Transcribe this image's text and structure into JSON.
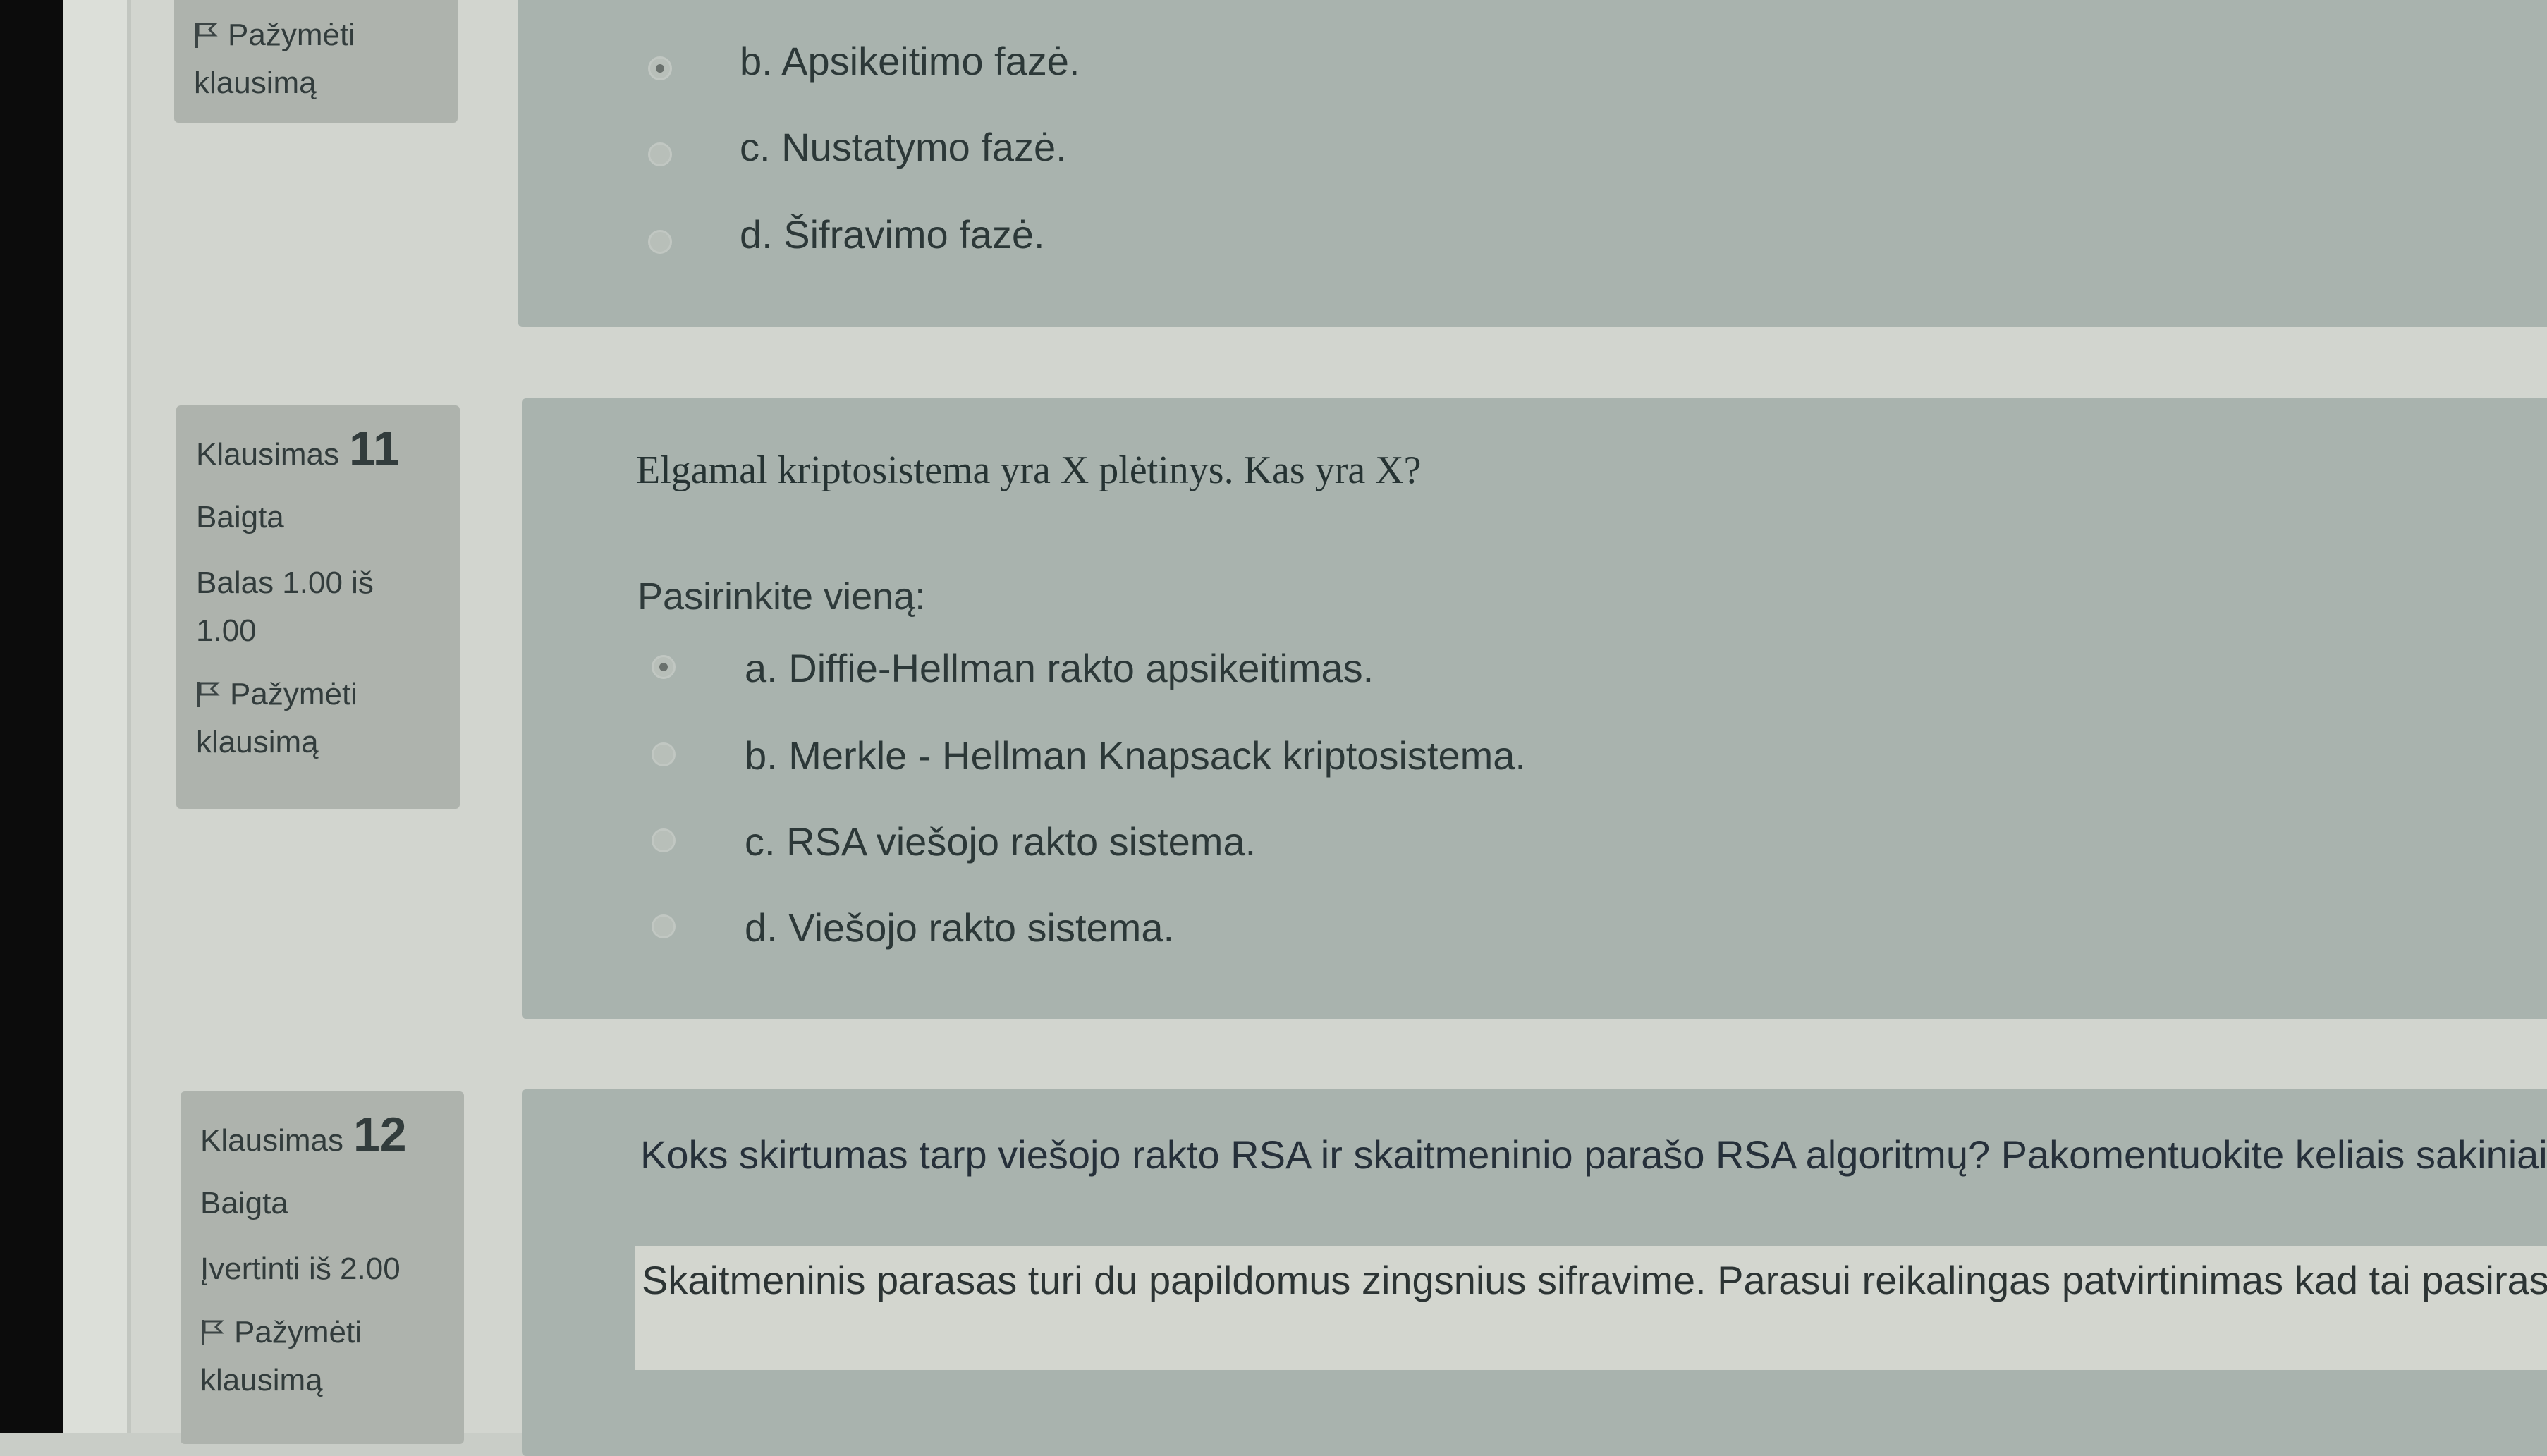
{
  "q10": {
    "flag_line1": "Pažymėti",
    "flag_line2": "klausimą",
    "answers": [
      {
        "text": "b. Apsikeitimo fazė.",
        "checked": true
      },
      {
        "text": "c. Nustatymo fazė.",
        "checked": false
      },
      {
        "text": "d. Šifravimo fazė.",
        "checked": false
      }
    ]
  },
  "q11": {
    "label": "Klausimas",
    "number": "11",
    "state": "Baigta",
    "grade": "Balas 1.00 iš 1.00",
    "flag_line1": "Pažymėti",
    "flag_line2": "klausimą",
    "question": "Elgamal kriptosistema yra X plėtinys. Kas yra X?",
    "prompt": "Pasirinkite vieną:",
    "answers": [
      {
        "text": "a. Diffie-Hellman rakto apsikeitimas.",
        "checked": true
      },
      {
        "text": "b. Merkle - Hellman Knapsack kriptosistema.",
        "checked": false
      },
      {
        "text": "c. RSA viešojo rakto sistema.",
        "checked": false
      },
      {
        "text": "d. Viešojo rakto sistema.",
        "checked": false
      }
    ]
  },
  "q12": {
    "label": "Klausimas",
    "number": "12",
    "state": "Baigta",
    "grade": "Įvertinti iš 2.00",
    "flag_line1": "Pažymėti",
    "flag_line2": "klausimą",
    "question": "Koks skirtumas tarp viešojo rakto RSA ir skaitmeninio parašo RSA algoritmų? Pakomentuokite keliais sakiniai",
    "response": "Skaitmeninis parasas turi du papildomus zingsnius sifravime. Parasui reikalingas patvirtinimas kad tai pasiras"
  }
}
